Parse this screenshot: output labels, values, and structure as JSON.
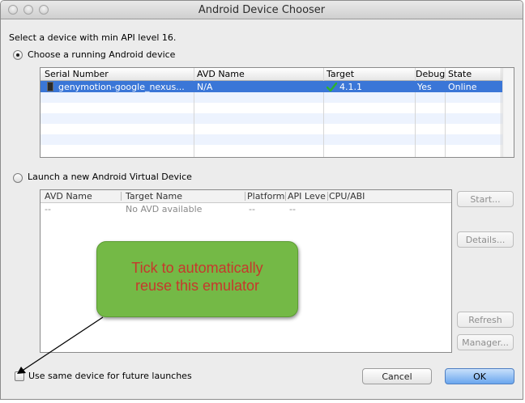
{
  "window": {
    "title": "Android Device Chooser"
  },
  "intro": "Select a device with min API level 16.",
  "running": {
    "radio_label": "Choose a running Android device",
    "selected": true,
    "columns": [
      "Serial Number",
      "AVD Name",
      "Target",
      "Debug",
      "State"
    ],
    "rows": [
      {
        "serial": "genymotion-google_nexus...",
        "avd": "N/A",
        "target": "4.1.1",
        "debug": "Yes",
        "state": "Online",
        "selected": true
      }
    ]
  },
  "launch": {
    "radio_label": "Launch a new Android Virtual Device",
    "selected": false,
    "columns": [
      "AVD Name",
      "Target Name",
      "Platform",
      "API Leve",
      "CPU/ABI"
    ],
    "rows": [
      {
        "avd": "--",
        "target": "No AVD available",
        "platform": "--",
        "api": "--",
        "cpu": ""
      }
    ]
  },
  "side_buttons": {
    "start": "Start...",
    "details": "Details...",
    "refresh": "Refresh",
    "manager": "Manager..."
  },
  "footer": {
    "checkbox_label": "Use same device for future launches",
    "checked": false,
    "cancel": "Cancel",
    "ok": "OK"
  },
  "annotation": {
    "line1": "Tick to automatically",
    "line2": "reuse this emulator"
  },
  "colors": {
    "selection": "#3a76d7",
    "callout_fill": "#74b946",
    "callout_text": "#c6382c",
    "checkmark": "#2db32d"
  },
  "icons": [
    "phone-icon",
    "checkmark-icon"
  ]
}
